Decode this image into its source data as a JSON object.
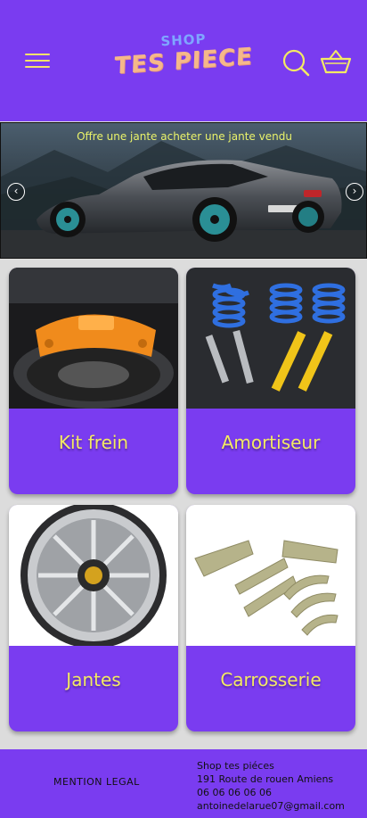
{
  "header": {
    "logo_top": "SHOP",
    "logo_main": "TES PIECE",
    "menu_icon": "hamburger-menu-icon",
    "search_icon": "search-icon",
    "cart_icon": "shopping-basket-icon"
  },
  "banner": {
    "promo_text": "Offre une jante acheter une jante vendu",
    "prev_icon": "chevron-left-icon",
    "next_icon": "chevron-right-icon",
    "prev_glyph": "‹",
    "next_glyph": "›"
  },
  "categories": [
    {
      "label": "Kit frein"
    },
    {
      "label": "Amortiseur"
    },
    {
      "label": "Jantes"
    },
    {
      "label": "Carrosserie"
    }
  ],
  "footer": {
    "legal": "MENTION LEGAL",
    "shop_name": "Shop tes piéces",
    "address": "191 Route de rouen Amiens",
    "phone": "06 06 06 06 06",
    "email": "antoinedelarue07@gmail.com"
  },
  "colors": {
    "brand_purple": "#7a3cf0",
    "accent_yellow": "#f3ea63",
    "page_bg": "#dcdcdc"
  }
}
